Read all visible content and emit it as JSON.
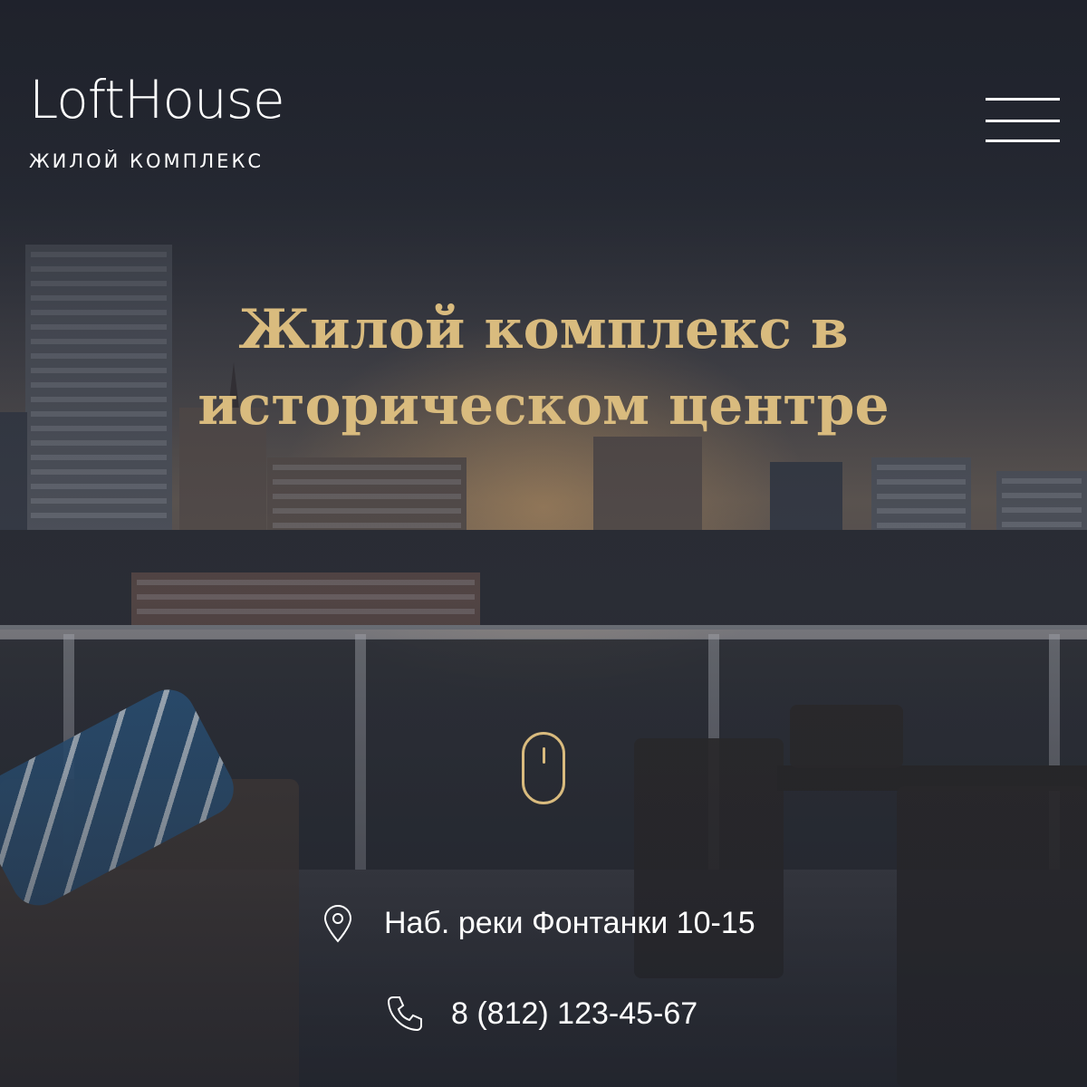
{
  "header": {
    "logo_text": "LoftHouse",
    "logo_subtitle": "ЖИЛОЙ КОМПЛЕКС",
    "menu_icon": "hamburger-menu-icon"
  },
  "hero": {
    "title": "Жилой комплекс в историческом центре",
    "scroll_icon": "mouse-scroll-icon"
  },
  "contacts": {
    "address_icon": "location-pin-icon",
    "address": "Наб. реки Фонтанки 10-15",
    "phone_icon": "phone-icon",
    "phone": "8 (812) 123-45-67"
  },
  "colors": {
    "accent": "#d9bb7e",
    "text": "#ffffff",
    "background": "#262a33"
  }
}
